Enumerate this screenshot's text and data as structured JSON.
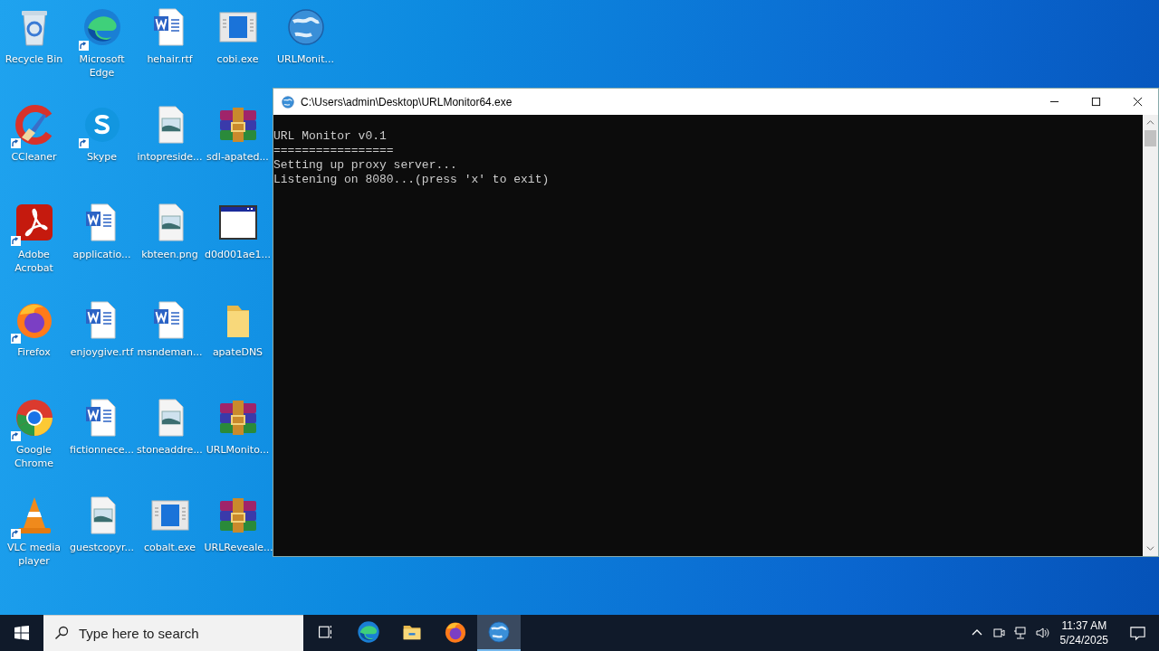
{
  "desktop_icons": [
    {
      "label": "Recycle Bin",
      "kind": "recycle",
      "shortcut": false
    },
    {
      "label": "Microsoft Edge",
      "kind": "edge",
      "shortcut": true
    },
    {
      "label": "hehair.rtf",
      "kind": "word",
      "shortcut": false
    },
    {
      "label": "cobi.exe",
      "kind": "exe",
      "shortcut": false
    },
    {
      "label": "URLMonit...",
      "kind": "globe",
      "shortcut": false
    },
    {
      "label": "CCleaner",
      "kind": "ccleaner",
      "shortcut": true
    },
    {
      "label": "Skype",
      "kind": "skype",
      "shortcut": true
    },
    {
      "label": "intopreside...",
      "kind": "image",
      "shortcut": false
    },
    {
      "label": "sdl-apated...",
      "kind": "archive",
      "shortcut": false
    },
    {
      "label": "Adobe Acrobat",
      "kind": "acrobat",
      "shortcut": true
    },
    {
      "label": "applicatio...",
      "kind": "word",
      "shortcut": false
    },
    {
      "label": "kbteen.png",
      "kind": "image",
      "shortcut": false
    },
    {
      "label": "d0d001ae1...",
      "kind": "app",
      "shortcut": false
    },
    {
      "label": "Firefox",
      "kind": "firefox",
      "shortcut": true
    },
    {
      "label": "enjoygive.rtf",
      "kind": "word",
      "shortcut": false
    },
    {
      "label": "msndeman...",
      "kind": "word",
      "shortcut": false
    },
    {
      "label": "apateDNS",
      "kind": "folder",
      "shortcut": false
    },
    {
      "label": "Google Chrome",
      "kind": "chrome",
      "shortcut": true
    },
    {
      "label": "fictionnece...",
      "kind": "word",
      "shortcut": false
    },
    {
      "label": "stoneaddre...",
      "kind": "image",
      "shortcut": false
    },
    {
      "label": "URLMonito...",
      "kind": "archive",
      "shortcut": false
    },
    {
      "label": "VLC media player",
      "kind": "vlc",
      "shortcut": true
    },
    {
      "label": "guestcopyr...",
      "kind": "image",
      "shortcut": false
    },
    {
      "label": "cobalt.exe",
      "kind": "exe",
      "shortcut": false
    },
    {
      "label": "URLReveale...",
      "kind": "archive",
      "shortcut": false
    }
  ],
  "console_window": {
    "title": "C:\\Users\\admin\\Desktop\\URLMonitor64.exe",
    "lines": [
      "URL Monitor v0.1",
      "=================",
      "Setting up proxy server...",
      "Listening on 8080...(press 'x' to exit)"
    ]
  },
  "taskbar": {
    "search": {
      "placeholder": "Type here to search"
    },
    "apps": [
      {
        "kind": "taskview",
        "selected": false
      },
      {
        "kind": "edge",
        "selected": false
      },
      {
        "kind": "explorer",
        "selected": false
      },
      {
        "kind": "firefox",
        "selected": false
      },
      {
        "kind": "globe",
        "selected": true
      }
    ],
    "time": "11:37 AM",
    "date": "5/24/2025"
  }
}
